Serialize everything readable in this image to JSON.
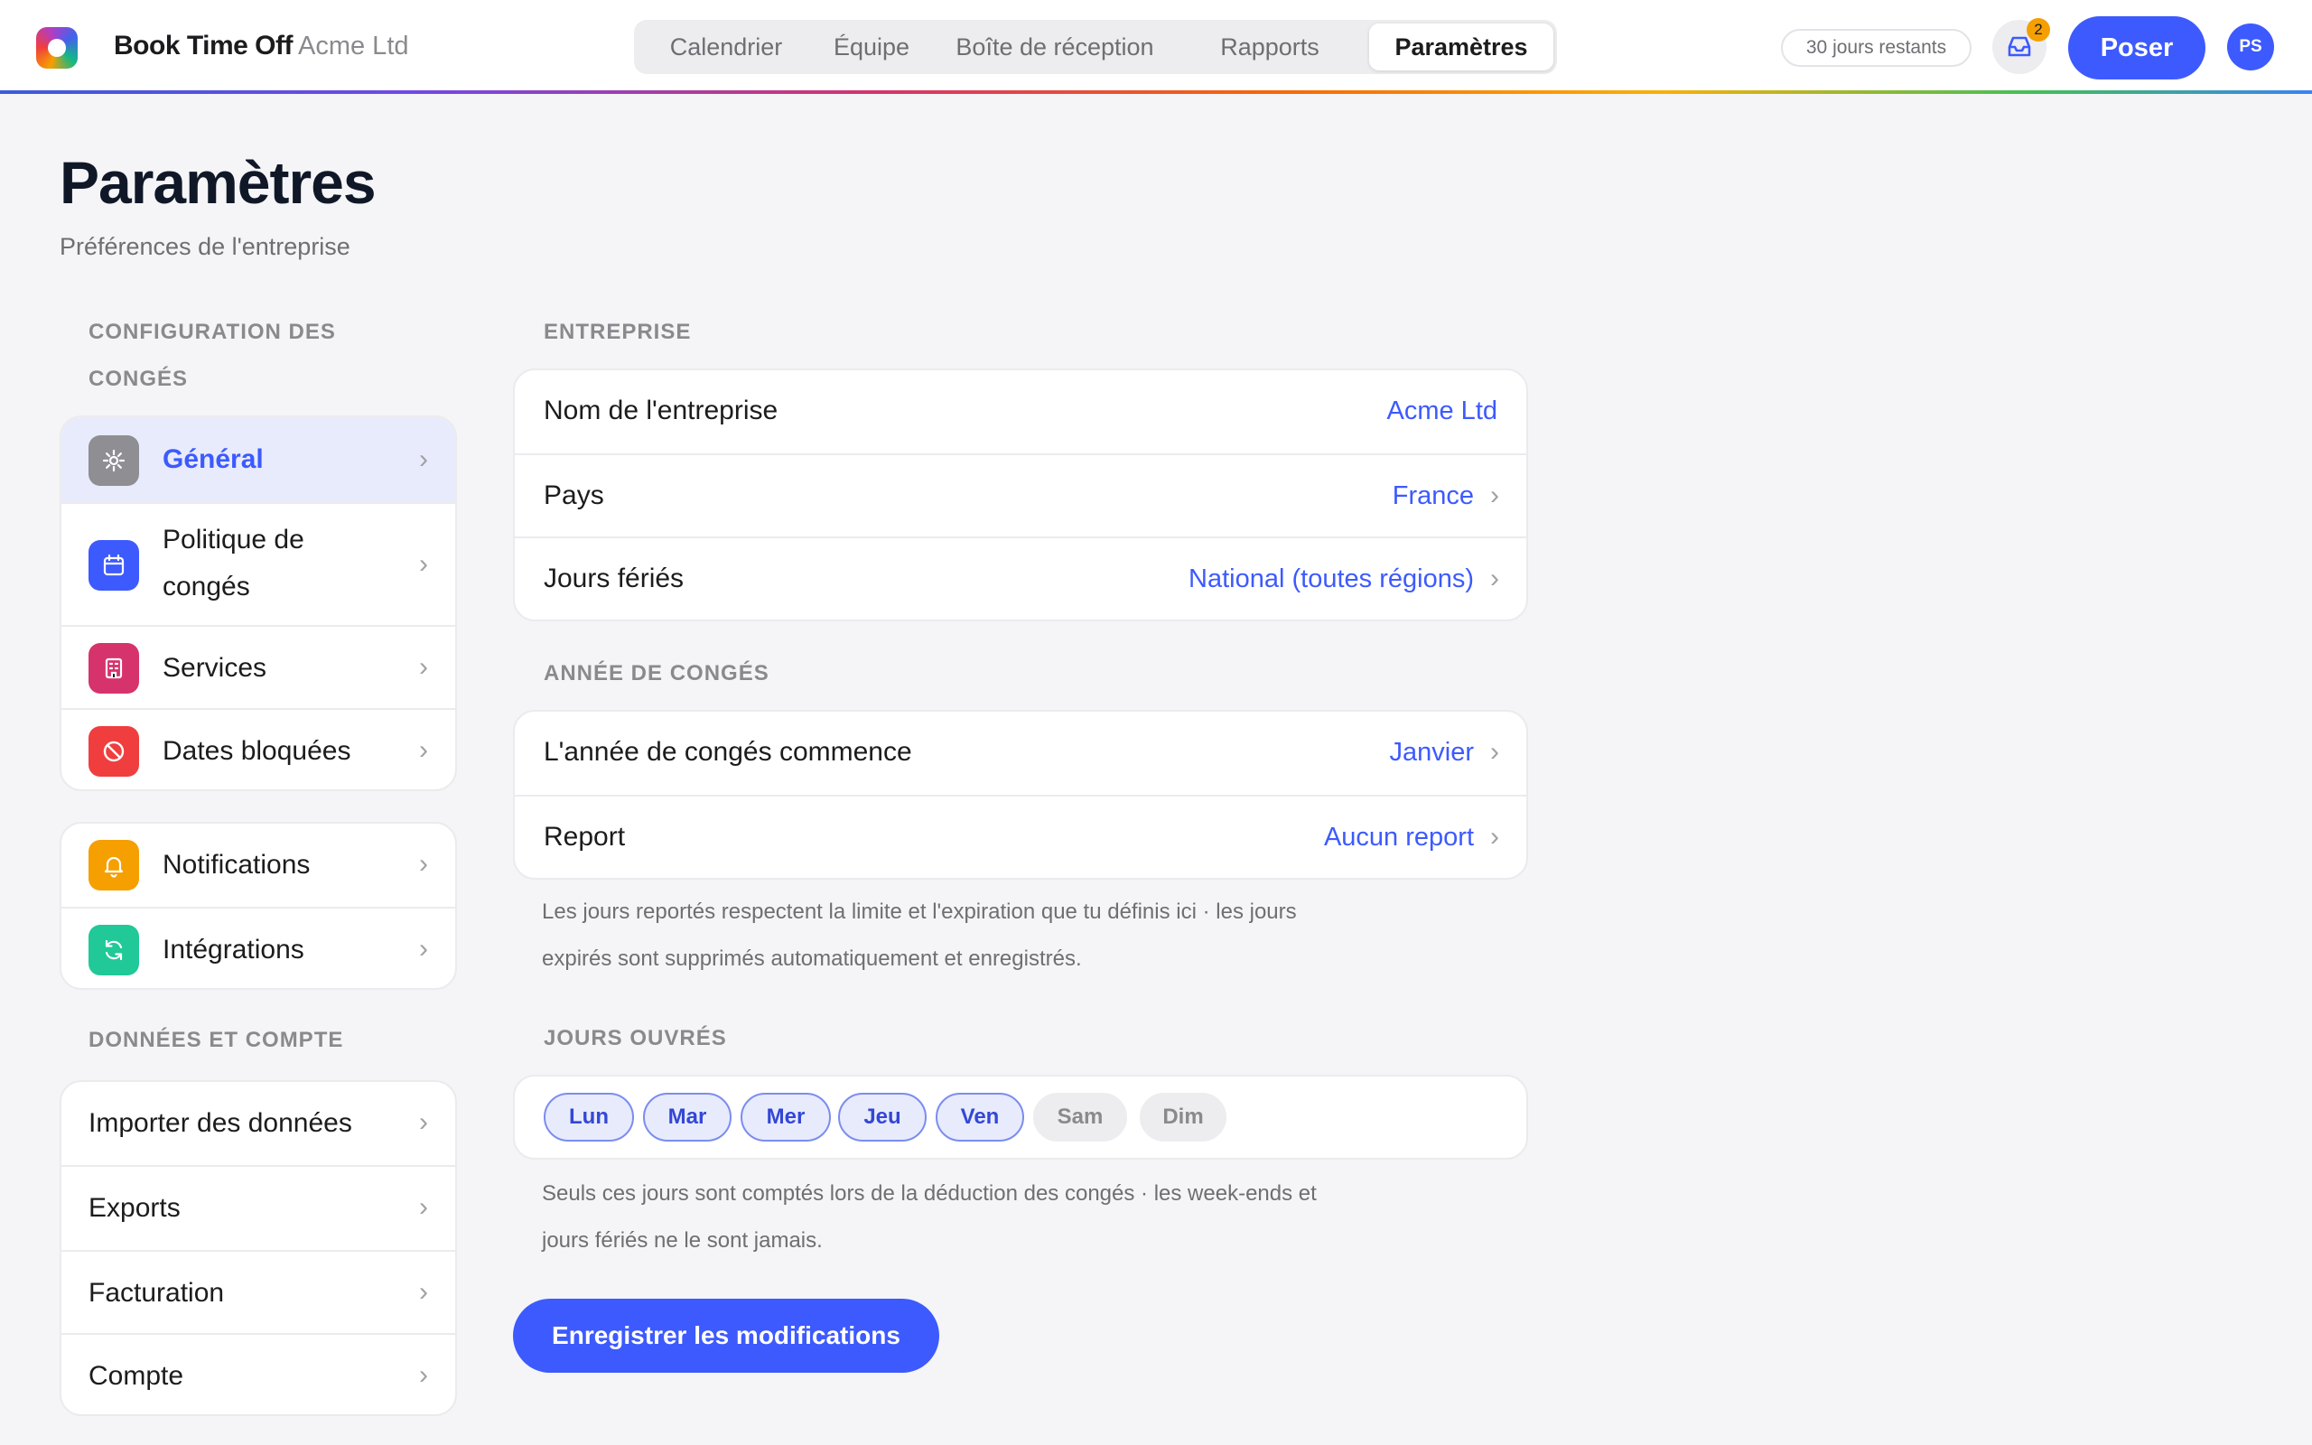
{
  "app": {
    "name": "Book Time Off",
    "company": "Acme Ltd"
  },
  "nav": {
    "tabs": [
      {
        "label": "Calendrier"
      },
      {
        "label": "Équipe"
      },
      {
        "label": "Boîte de réception"
      },
      {
        "label": "Rapports"
      },
      {
        "label": "Paramètres",
        "active": true
      }
    ]
  },
  "header": {
    "days_left": "30 jours restants",
    "inbox_count": "2",
    "request_label": "Poser",
    "avatar_initials": "PS"
  },
  "page": {
    "title": "Paramètres",
    "subtitle": "Préférences de l'entreprise"
  },
  "sidebar": {
    "section_leave": "CONFIGURATION DES CONGÉS",
    "leave_items": [
      {
        "label": "Général",
        "icon": "gear-icon",
        "color": "#8e8e93",
        "active": true
      },
      {
        "label": "Politique de congés",
        "icon": "calendar-icon",
        "color": "#3d5afe"
      },
      {
        "label": "Services",
        "icon": "building-icon",
        "color": "#d6336c"
      },
      {
        "label": "Dates bloquées",
        "icon": "block-icon",
        "color": "#f03e3e"
      }
    ],
    "other_items": [
      {
        "label": "Notifications",
        "icon": "bell-icon",
        "color": "#f59f00"
      },
      {
        "label": "Intégrations",
        "icon": "sync-icon",
        "color": "#20c997"
      }
    ],
    "section_data": "DONNÉES ET COMPTE",
    "data_items": [
      {
        "label": "Importer des données"
      },
      {
        "label": "Exports"
      },
      {
        "label": "Facturation"
      },
      {
        "label": "Compte"
      }
    ]
  },
  "company": {
    "section": "ENTREPRISE",
    "rows": [
      {
        "key": "Nom de l'entreprise",
        "value": "Acme Ltd"
      },
      {
        "key": "Pays",
        "value": "France"
      },
      {
        "key": "Jours fériés",
        "value": "National (toutes régions)"
      }
    ]
  },
  "leave_year": {
    "section": "ANNÉE DE CONGÉS",
    "rows": [
      {
        "key": "L'année de congés commence",
        "value": "Janvier"
      },
      {
        "key": "Report",
        "value": "Aucun report"
      }
    ],
    "help_line1": "Les jours reportés respectent la limite et l'expiration que tu définis ici · les jours",
    "help_line2": "expirés sont supprimés automatiquement et enregistrés."
  },
  "working_days": {
    "section": "JOURS OUVRÉS",
    "days": [
      {
        "label": "Lun",
        "on": true
      },
      {
        "label": "Mar",
        "on": true
      },
      {
        "label": "Mer",
        "on": true
      },
      {
        "label": "Jeu",
        "on": true
      },
      {
        "label": "Ven",
        "on": true
      },
      {
        "label": "Sam",
        "on": false
      },
      {
        "label": "Dim",
        "on": false
      }
    ],
    "help_line1": "Seuls ces jours sont comptés lors de la déduction des congés · les week-ends et",
    "help_line2": "jours fériés ne le sont jamais."
  },
  "actions": {
    "save_label": "Enregistrer les modifications"
  },
  "colors": {
    "accent": "#3d5afe",
    "badge": "#f59f00"
  }
}
